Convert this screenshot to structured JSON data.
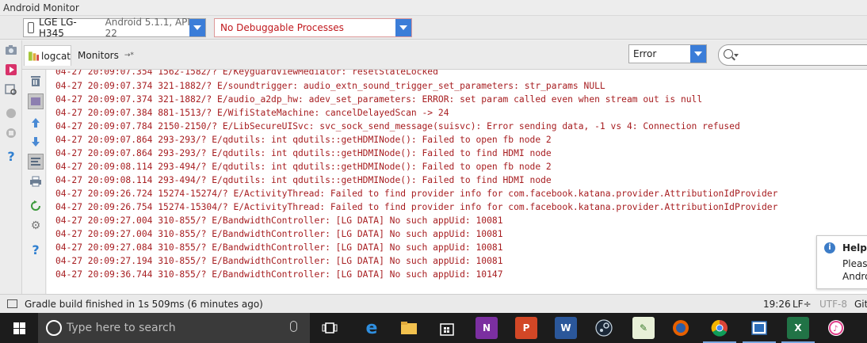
{
  "window": {
    "title": "Android Monitor"
  },
  "device_selector": {
    "device": "LGE LG-H345",
    "detail": "Android 5.1.1, API 22"
  },
  "process_selector": {
    "value": "No Debuggable Processes",
    "color": "#c0171c"
  },
  "tabs": [
    {
      "label": "logcat",
      "active": true
    },
    {
      "label": "Monitors",
      "suffix": "→*",
      "active": false
    }
  ],
  "log_level": {
    "value": "Error"
  },
  "search": {
    "placeholder": ""
  },
  "log_lines": [
    "04-27 20:09:07.354 1562-1582/? E/KeyguardViewMediator: resetStateLocked",
    "04-27 20:09:07.374 321-1882/? E/soundtrigger: audio_extn_sound_trigger_set_parameters: str_params NULL",
    "04-27 20:09:07.374 321-1882/? E/audio_a2dp_hw: adev_set_parameters: ERROR: set param called even when stream out is null",
    "04-27 20:09:07.384 881-1513/? E/WifiStateMachine: cancelDelayedScan -> 24",
    "04-27 20:09:07.784 2150-2150/? E/LibSecureUISvc: svc_sock_send_message(suisvc): Error sending data, -1 vs 4: Connection refused",
    "04-27 20:09:07.864 293-293/? E/qdutils: int qdutils::getHDMINode(): Failed to open fb node 2",
    "04-27 20:09:07.864 293-293/? E/qdutils: int qdutils::getHDMINode(): Failed to find HDMI node",
    "04-27 20:09:08.114 293-494/? E/qdutils: int qdutils::getHDMINode(): Failed to open fb node 2",
    "04-27 20:09:08.114 293-494/? E/qdutils: int qdutils::getHDMINode(): Failed to find HDMI node",
    "04-27 20:09:26.724 15274-15274/? E/ActivityThread: Failed to find provider info for com.facebook.katana.provider.AttributionIdProvider",
    "04-27 20:09:26.754 15274-15304/? E/ActivityThread: Failed to find provider info for com.facebook.katana.provider.AttributionIdProvider",
    "04-27 20:09:27.004 310-855/? E/BandwidthController: [LG DATA] No such appUid: 10081",
    "04-27 20:09:27.004 310-855/? E/BandwidthController: [LG DATA] No such appUid: 10081",
    "04-27 20:09:27.084 310-855/? E/BandwidthController: [LG DATA] No such appUid: 10081",
    "04-27 20:09:27.194 310-855/? E/BandwidthController: [LG DATA] No such appUid: 10081",
    "04-27 20:09:36.744 310-855/? E/BandwidthController: [LG DATA] No such appUid: 10147"
  ],
  "help_popup": {
    "title": "Help i",
    "line1": "Please",
    "line2": "Andro"
  },
  "status_bar": {
    "message": "Gradle build finished in 1s 509ms (6 minutes ago)",
    "position": "19:26",
    "line_sep": "LF÷",
    "encoding": "UTF-8",
    "vcs": "Git"
  },
  "taskbar": {
    "search_placeholder": "Type here to search",
    "apps": [
      "task-view",
      "edge",
      "file-explorer",
      "store",
      "onenote",
      "powerpoint",
      "word",
      "steam",
      "notepad",
      "firefox",
      "chrome",
      "blue-app",
      "excel",
      "itunes"
    ]
  },
  "colors": {
    "accent": "#3b7dd8",
    "error_text": "#a71d20"
  }
}
